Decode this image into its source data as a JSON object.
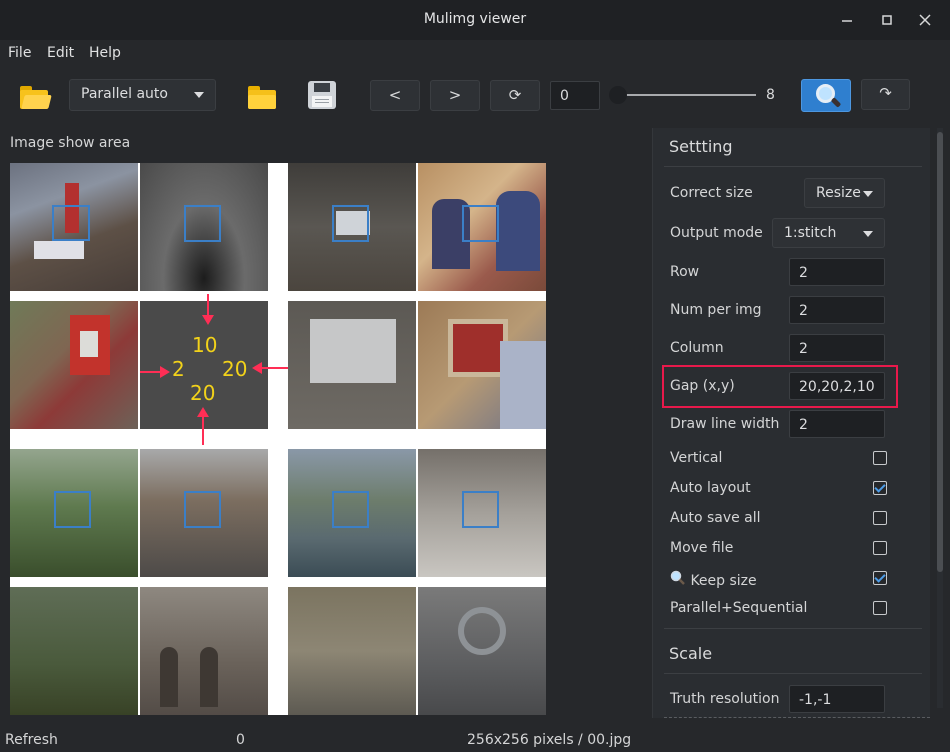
{
  "window": {
    "title": "Mulimg viewer",
    "controls": [
      "minimize",
      "maximize",
      "close"
    ]
  },
  "menu": {
    "file": "File",
    "edit": "Edit",
    "help": "Help"
  },
  "toolbar": {
    "mode_value": "Parallel auto",
    "prev_label": "<",
    "next_label": ">",
    "refresh_label": "⟳",
    "index_value": "0",
    "slider_value": 0,
    "slider_max_label": "8",
    "rotate_label": "↷"
  },
  "image_area": {
    "label": "Image show area",
    "annotations": {
      "top": "10",
      "left": "2",
      "right": "20",
      "bottom": "20"
    }
  },
  "settings": {
    "title": "Settting",
    "correct_size_label": "Correct size",
    "correct_size_value": "Resize",
    "output_mode_label": "Output mode",
    "output_mode_value": "1:stitch",
    "row_label": "Row",
    "row_value": "2",
    "num_per_img_label": "Num per img",
    "num_per_img_value": "2",
    "column_label": "Column",
    "column_value": "2",
    "gap_label": "Gap (x,y)",
    "gap_value": "20,20,2,10",
    "draw_line_width_label": "Draw line width",
    "draw_line_width_value": "2",
    "vertical_label": "Vertical",
    "vertical_checked": false,
    "auto_layout_label": "Auto layout",
    "auto_layout_checked": true,
    "auto_save_all_label": "Auto save all",
    "auto_save_all_checked": false,
    "move_file_label": "Move file",
    "move_file_checked": false,
    "keep_size_label": "Keep size",
    "keep_size_icon": "magnifier-icon",
    "keep_size_checked": true,
    "parallel_sequential_label": "Parallel+Sequential",
    "parallel_sequential_checked": false
  },
  "scale": {
    "title": "Scale",
    "truth_resolution_label": "Truth resolution",
    "truth_resolution_value": "-1,-1"
  },
  "status": {
    "left": "Refresh",
    "middle": "0",
    "right": "256x256 pixels / 00.jpg"
  },
  "colors": {
    "accent": "#2f7fcf",
    "highlight": "#e8194b",
    "annotation_text": "#f2d21a",
    "annotation_arrow": "#ff2e55",
    "selection_box": "#3b7fc7"
  }
}
